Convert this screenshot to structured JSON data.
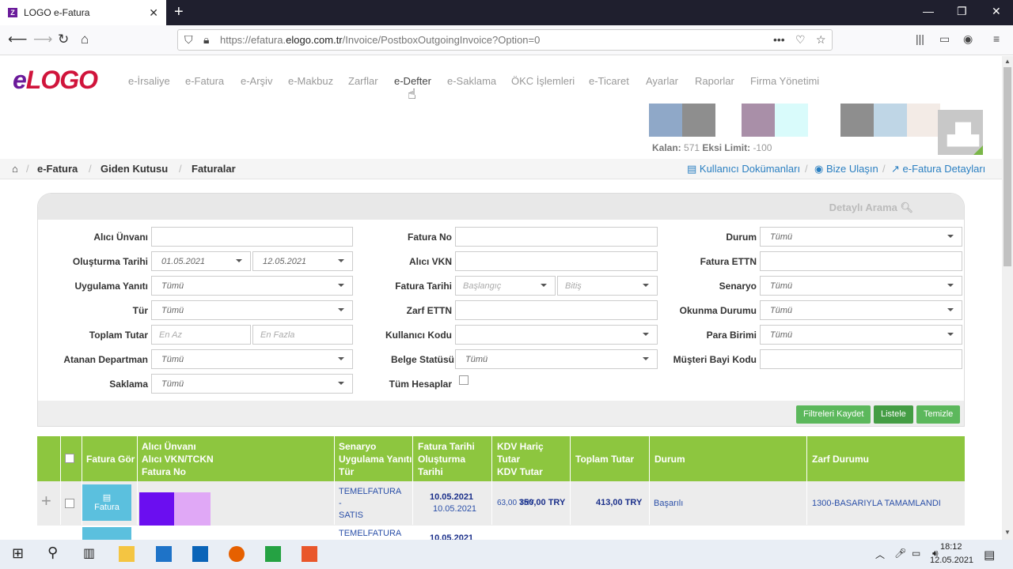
{
  "browser": {
    "tab_title": "LOGO e-Fatura",
    "tab_close": "✕",
    "new_tab": "+",
    "url_prefix": "https://efatura.",
    "url_domain": "elogo.com.tr",
    "url_path": "/Invoice/PostboxOutgoingInvoice?Option=0",
    "win_minimize": "—",
    "win_maximize": "❐",
    "win_close": "✕"
  },
  "logo": {
    "e": "e",
    "rest": "LOGO"
  },
  "menu": [
    "e-İrsaliye",
    "e-Fatura",
    "e-Arşiv",
    "e-Makbuz",
    "Zarflar",
    "e-Defter",
    "e-Saklama",
    "ÖKC İşlemleri",
    "e-Ticaret",
    "Ayarlar",
    "Raporlar",
    "Firma Yönetimi"
  ],
  "swatch_colors": [
    "#8fa8c8",
    "#8e8e8e",
    "#ffffff",
    "#a98fa8",
    "#d9fbfb",
    "#ffffff",
    "#8e8e8e",
    "#bfd6e6",
    "#f3ebe6"
  ],
  "limits": {
    "kalan_label": "Kalan:",
    "kalan_value": "571",
    "eksi_label": "Eksi Limit:",
    "eksi_value": "-100"
  },
  "breadcrumb": {
    "home_icon": "home-icon",
    "items": [
      "e-Fatura",
      "Giden Kutusu",
      "Faturalar"
    ],
    "links": [
      "Kullanıcı Dokümanları",
      "Bize Ulaşın",
      "e-Fatura Detayları"
    ]
  },
  "search": {
    "title": "Detaylı Arama",
    "col1": {
      "alici_unvani": "Alıcı Ünvanı",
      "olusturma_tarihi": "Oluşturma Tarihi",
      "olusturma_from": "01.05.2021",
      "olusturma_to": "12.05.2021",
      "uygulama_yaniti": "Uygulama Yanıtı",
      "tur": "Tür",
      "toplam_tutar": "Toplam Tutar",
      "en_az": "En Az",
      "en_fazla": "En Fazla",
      "atanan_departman": "Atanan Departman",
      "saklama": "Saklama"
    },
    "col2": {
      "fatura_no": "Fatura No",
      "alici_vkn": "Alıcı VKN",
      "fatura_tarihi": "Fatura Tarihi",
      "baslangic": "Başlangıç",
      "bitis": "Bitiş",
      "zarf_ettn": "Zarf ETTN",
      "kullanici_kodu": "Kullanıcı Kodu",
      "belge_statusu": "Belge Statüsü",
      "tum_hesaplar": "Tüm Hesaplar"
    },
    "col3": {
      "durum": "Durum",
      "fatura_ettn": "Fatura ETTN",
      "senaryo": "Senaryo",
      "okunma_durumu": "Okunma Durumu",
      "para_birimi": "Para Birimi",
      "musteri_bayi_kodu": "Müşteri Bayi Kodu"
    },
    "all_option": "Tümü",
    "buttons": {
      "save_filters": "Filtreleri Kaydet",
      "list": "Listele",
      "clear": "Temizle"
    }
  },
  "grid": {
    "headers": {
      "fatura_gor": "Fatura Gör",
      "alici": [
        "Alıcı Ünvanı",
        "Alıcı VKN/TCKN",
        "Fatura No"
      ],
      "senaryo": [
        "Senaryo",
        "Uygulama Yanıtı",
        "Tür"
      ],
      "tarih": [
        "Fatura Tarihi",
        "Oluşturma",
        "Tarihi"
      ],
      "kdv": [
        "KDV Hariç",
        "Tutar",
        "KDV Tutar"
      ],
      "toplam": "Toplam Tutar",
      "durum": "Durum",
      "zarf": "Zarf Durumu"
    },
    "rows": [
      {
        "expand": "+",
        "fatura_btn": "Fatura",
        "senaryo": [
          "TEMELFATURA",
          "-",
          "SATIS"
        ],
        "fatura_tarihi": "10.05.2021",
        "olusturma_tarihi": "10.05.2021",
        "kdv_tutar": "63,00 TRY",
        "kdv_haric": "350,00 TRY",
        "toplam": "413,00 TRY",
        "durum": "Başarılı",
        "zarf": "1300-BASARIYLA TAMAMLANDI"
      },
      {
        "senaryo": [
          "TEMELFATURA"
        ],
        "fatura_tarihi": "10.05.2021"
      }
    ]
  },
  "taskbar": {
    "time": "18:12",
    "date": "12.05.2021"
  }
}
